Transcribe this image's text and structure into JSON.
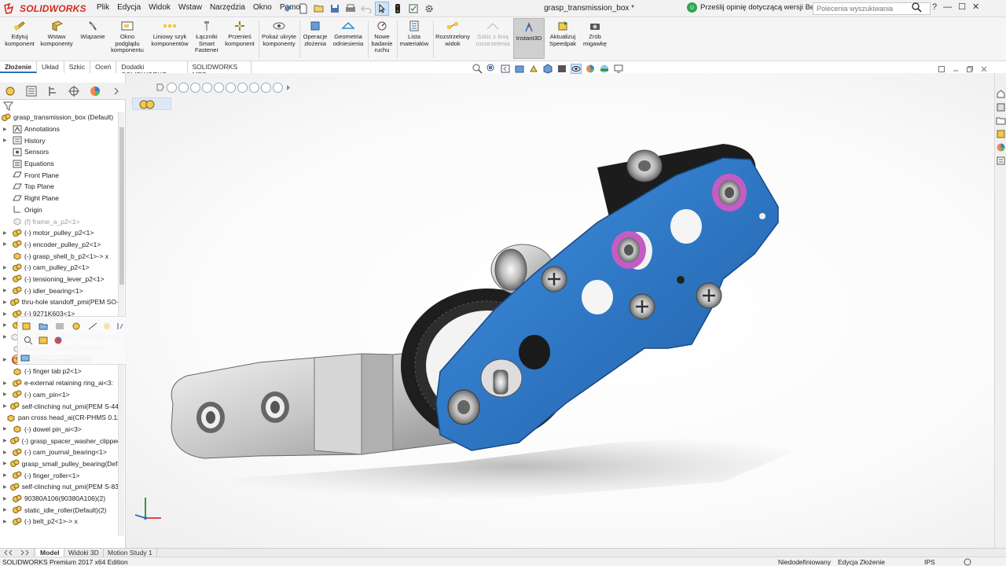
{
  "app": {
    "brand": "SOLIDWORKS",
    "document_title": "grasp_transmission_box *",
    "menus": [
      "Plik",
      "Edycja",
      "Widok",
      "Wstaw",
      "Narzędzia",
      "Okno",
      "Pomoc"
    ],
    "feedback_text": "Prześlij opinię dotyczącą wersji Beta",
    "search_placeholder": "Polecenia wyszukiwania",
    "win_help": "?",
    "win_min": "—",
    "win_max": "☐",
    "win_close": "✕"
  },
  "command_manager": {
    "commands": [
      {
        "label": "Edytuj\nkomponent",
        "icon": "edit-component-icon"
      },
      {
        "label": "Wstaw\nkomponenty",
        "icon": "insert-components-icon"
      },
      {
        "label": "Wiązanie",
        "icon": "mate-icon"
      },
      {
        "label": "Okno\npodglądu\nkomponentu",
        "icon": "component-preview-icon"
      },
      {
        "label": "Liniowy szyk\nkomponentów",
        "icon": "linear-pattern-icon"
      },
      {
        "label": "Łączniki\nSmart\nFastener",
        "icon": "smart-fasteners-icon"
      },
      {
        "label": "Przenieś\nkomponent",
        "icon": "move-component-icon"
      },
      {
        "label": "Pokaż ukryte\nkomponenty",
        "icon": "show-hidden-icon"
      },
      {
        "label": "Operacje\nzłożenia",
        "icon": "assembly-features-icon"
      },
      {
        "label": "Geometria\nodniesienia",
        "icon": "reference-geometry-icon"
      },
      {
        "label": "Nowe\nbadanie\nruchu",
        "icon": "new-motion-study-icon"
      },
      {
        "label": "Lista\nmateriałów",
        "icon": "bill-of-materials-icon"
      },
      {
        "label": "Rozstrzelony\nwidok",
        "icon": "exploded-view-icon"
      },
      {
        "label": "Szkic z linią\nrozstrzelenia",
        "icon": "explode-line-sketch-icon"
      },
      {
        "label": "Instant3D",
        "icon": "instant3d-icon"
      },
      {
        "label": "Aktualizuj\nSpeedpak",
        "icon": "update-speedpak-icon"
      },
      {
        "label": "Zrób\nmigawkę",
        "icon": "take-snapshot-icon"
      }
    ]
  },
  "tabs": [
    "Złożenie",
    "Układ",
    "Szkic",
    "Oceń",
    "Dodatki SOLIDWORKS",
    "SOLIDWORKS MBD"
  ],
  "tree": {
    "root": "grasp_transmission_box  (Default)",
    "items": [
      {
        "label": "Annotations",
        "arrow": "▶",
        "kind": "annotations"
      },
      {
        "label": "History",
        "arrow": "▶",
        "kind": "history"
      },
      {
        "label": "Sensors",
        "arrow": "",
        "kind": "sensors"
      },
      {
        "label": "Equations",
        "arrow": "",
        "kind": "equations"
      },
      {
        "label": "Front Plane",
        "arrow": "",
        "kind": "plane"
      },
      {
        "label": "Top Plane",
        "arrow": "",
        "kind": "plane"
      },
      {
        "label": "Right Plane",
        "arrow": "",
        "kind": "plane"
      },
      {
        "label": "Origin",
        "arrow": "",
        "kind": "origin"
      },
      {
        "label": "(f) frame_a_p2<1>",
        "arrow": "",
        "kind": "part-grey"
      },
      {
        "label": "(-) motor_pulley_p2<1>",
        "arrow": "▶",
        "kind": "assembly"
      },
      {
        "label": "(-) encoder_pulley_p2<1>",
        "arrow": "▶",
        "kind": "assembly"
      },
      {
        "label": "(-) grasp_shell_b_p2<1>-> x",
        "arrow": "",
        "kind": "part"
      },
      {
        "label": "(-) cam_pulley_p2<1>",
        "arrow": "▶",
        "kind": "assembly"
      },
      {
        "label": "(-) tensioning_lever_p2<1>",
        "arrow": "▶",
        "kind": "assembly"
      },
      {
        "label": "(-) idler_bearing<1>",
        "arrow": "▶",
        "kind": "assembly"
      },
      {
        "label": "thru-hole standoff_pmi(PEM SO-",
        "arrow": "▶",
        "kind": "assembly"
      },
      {
        "label": "(-) 9271K603<1>",
        "arrow": "▶",
        "kind": "assembly"
      },
      {
        "label": "(-) ",
        "arrow": "▶",
        "kind": "assembly"
      },
      {
        "label": "ball_bearing_9125_5T155K313(37",
        "arrow": "▶",
        "kind": "part-grey"
      },
      {
        "label": "encoder_magnet_small<1>",
        "arrow": "",
        "kind": "part-grey"
      },
      {
        "label": "(-) Frame-export1<1>",
        "arrow": "▶",
        "kind": "assembly",
        "selected": true
      },
      {
        "label": "(-) finger tab p2<1>",
        "arrow": "",
        "kind": "part"
      },
      {
        "label": "e-external retaining ring_ai<3:",
        "arrow": "▶",
        "kind": "assembly"
      },
      {
        "label": "(-) cam_pin<1>",
        "arrow": "▶",
        "kind": "assembly"
      },
      {
        "label": "self-clinching nut_pmi(PEM S-44",
        "arrow": "▶",
        "kind": "assembly"
      },
      {
        "label": "pan cross head_ai(CR-PHMS 0.11",
        "arrow": "",
        "kind": "part"
      },
      {
        "label": "(-) dowel pin_ai<3>",
        "arrow": "▶",
        "kind": "part"
      },
      {
        "label": "(-) grasp_spacer_washer_clipped-",
        "arrow": "▶",
        "kind": "assembly"
      },
      {
        "label": "(-) cam_journal_bearing<1>",
        "arrow": "▶",
        "kind": "assembly"
      },
      {
        "label": "grasp_small_pulley_bearing(Defa",
        "arrow": "▶",
        "kind": "assembly"
      },
      {
        "label": "(-) finger_roller<1>",
        "arrow": "▶",
        "kind": "assembly"
      },
      {
        "label": "self-clinching nut_pmi(PEM S-83",
        "arrow": "▶",
        "kind": "assembly"
      },
      {
        "label": "90380A106(90380A106)(2)",
        "arrow": "▶",
        "kind": "assembly"
      },
      {
        "label": "static_idle_roller(Default)(2)",
        "arrow": "▶",
        "kind": "assembly"
      },
      {
        "label": "(-) belt_p2<1>-> x",
        "arrow": "▶",
        "kind": "assembly"
      }
    ]
  },
  "bottom_tabs": [
    "Model",
    "Widoki 3D",
    "Motion Study 1"
  ],
  "status": {
    "edition": "SOLIDWORKS Premium 2017 x64 Edition",
    "definition": "Niedodefiniowany",
    "mode": "Edycja Złożenie",
    "units": "IPS"
  },
  "colors": {
    "accent": "#2b6fba",
    "brand_red": "#d52b1e",
    "blue_part": "#2f7fd0",
    "magenta_bearing": "#c45cc4",
    "selection": "#c7dcf3"
  }
}
